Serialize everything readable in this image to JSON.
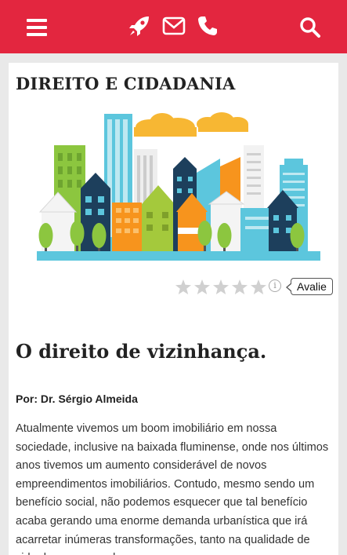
{
  "header": {
    "icons": [
      "menu-icon",
      "rocket-icon",
      "mail-icon",
      "phone-icon",
      "search-icon"
    ],
    "background_color": "#e3263f"
  },
  "section": {
    "title": "DIREITO E CIDADANIA"
  },
  "rating": {
    "stars_total": 5,
    "stars_filled": 0,
    "info_glyph": "i",
    "button_label": "Avalie"
  },
  "article": {
    "title": "O direito de vizinhança.",
    "byline": "Por: Dr. Sérgio Almeida",
    "body": "Atualmente vivemos um boom imobiliário em nossa sociedade, inclusive na baixada fluminense, onde nos últimos anos tivemos um aumento considerável de novos empreendimentos imobiliários. Contudo, mesmo sendo um benefício social, não podemos esquecer que tal benefício acaba gerando uma enorme demanda urbanística que irá acarretar inúmeras transformações, tanto na qualidade de vida de seus moradores,"
  }
}
